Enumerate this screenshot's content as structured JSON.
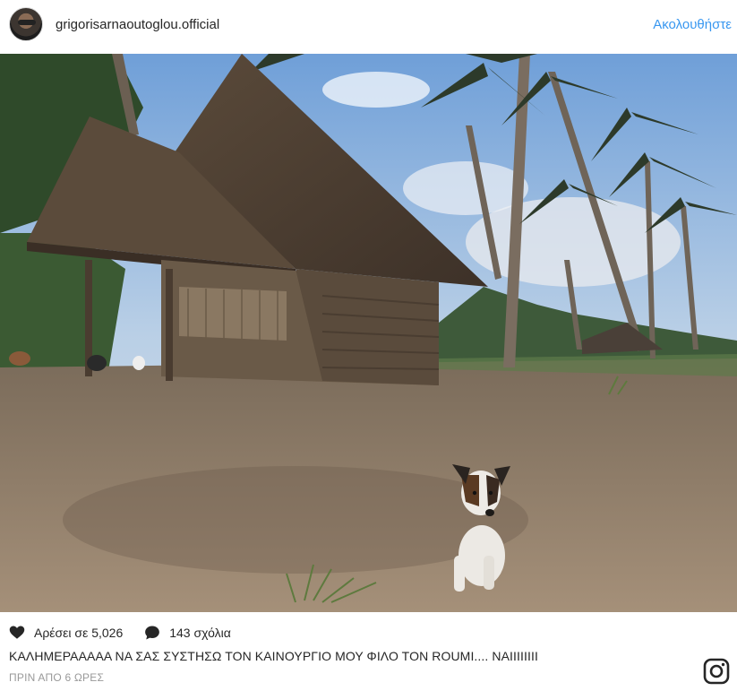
{
  "post": {
    "username": "grigorisarnaoutoglou.official",
    "follow_label": "Ακολουθήστε",
    "likes_label": "Αρέσει σε 5,026",
    "comments_label": "143 σχόλια",
    "caption": "ΚΑΛΗΜΕΡΑΑΑΑΑ ΝΑ ΣΑΣ ΣΥΣΤΗΣΩ ΤΟΝ ΚΑΙΝΟΥΡΓΙΟ ΜΟΥ ΦΙΛΟ ΤΟΝ ROUMI.... ΝΑΙΙΙΙΙΙΙΙ",
    "timestamp": "ΠΡΙΝ ΑΠΟ 6 ΩΡΕΣ"
  },
  "icons": {
    "heart": "heart-icon",
    "comment": "comment-bubble-icon",
    "instagram": "instagram-logo-icon"
  },
  "colors": {
    "follow_link": "#3897f0",
    "text": "#262626",
    "muted": "#999999"
  }
}
